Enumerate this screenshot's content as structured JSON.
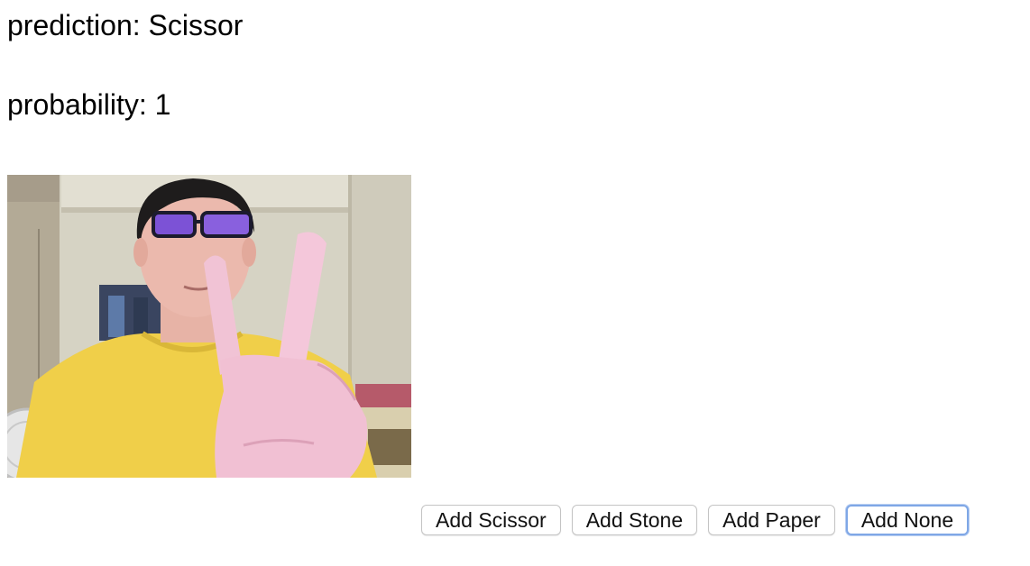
{
  "prediction": {
    "label": "prediction:",
    "value": "Scissor",
    "text": "prediction: Scissor"
  },
  "probability": {
    "label": "probability:",
    "value": "1",
    "text": "probability: 1"
  },
  "webcam": {
    "icon": "webcam-feed-image"
  },
  "buttons": [
    {
      "label": "Add Scissor"
    },
    {
      "label": "Add Stone"
    },
    {
      "label": "Add Paper"
    },
    {
      "label": "Add None",
      "focused": true
    }
  ],
  "colors": {
    "focus_ring": "#7fa7e6",
    "shirt": "#f2d24a",
    "wall": "#d9d6c8"
  }
}
